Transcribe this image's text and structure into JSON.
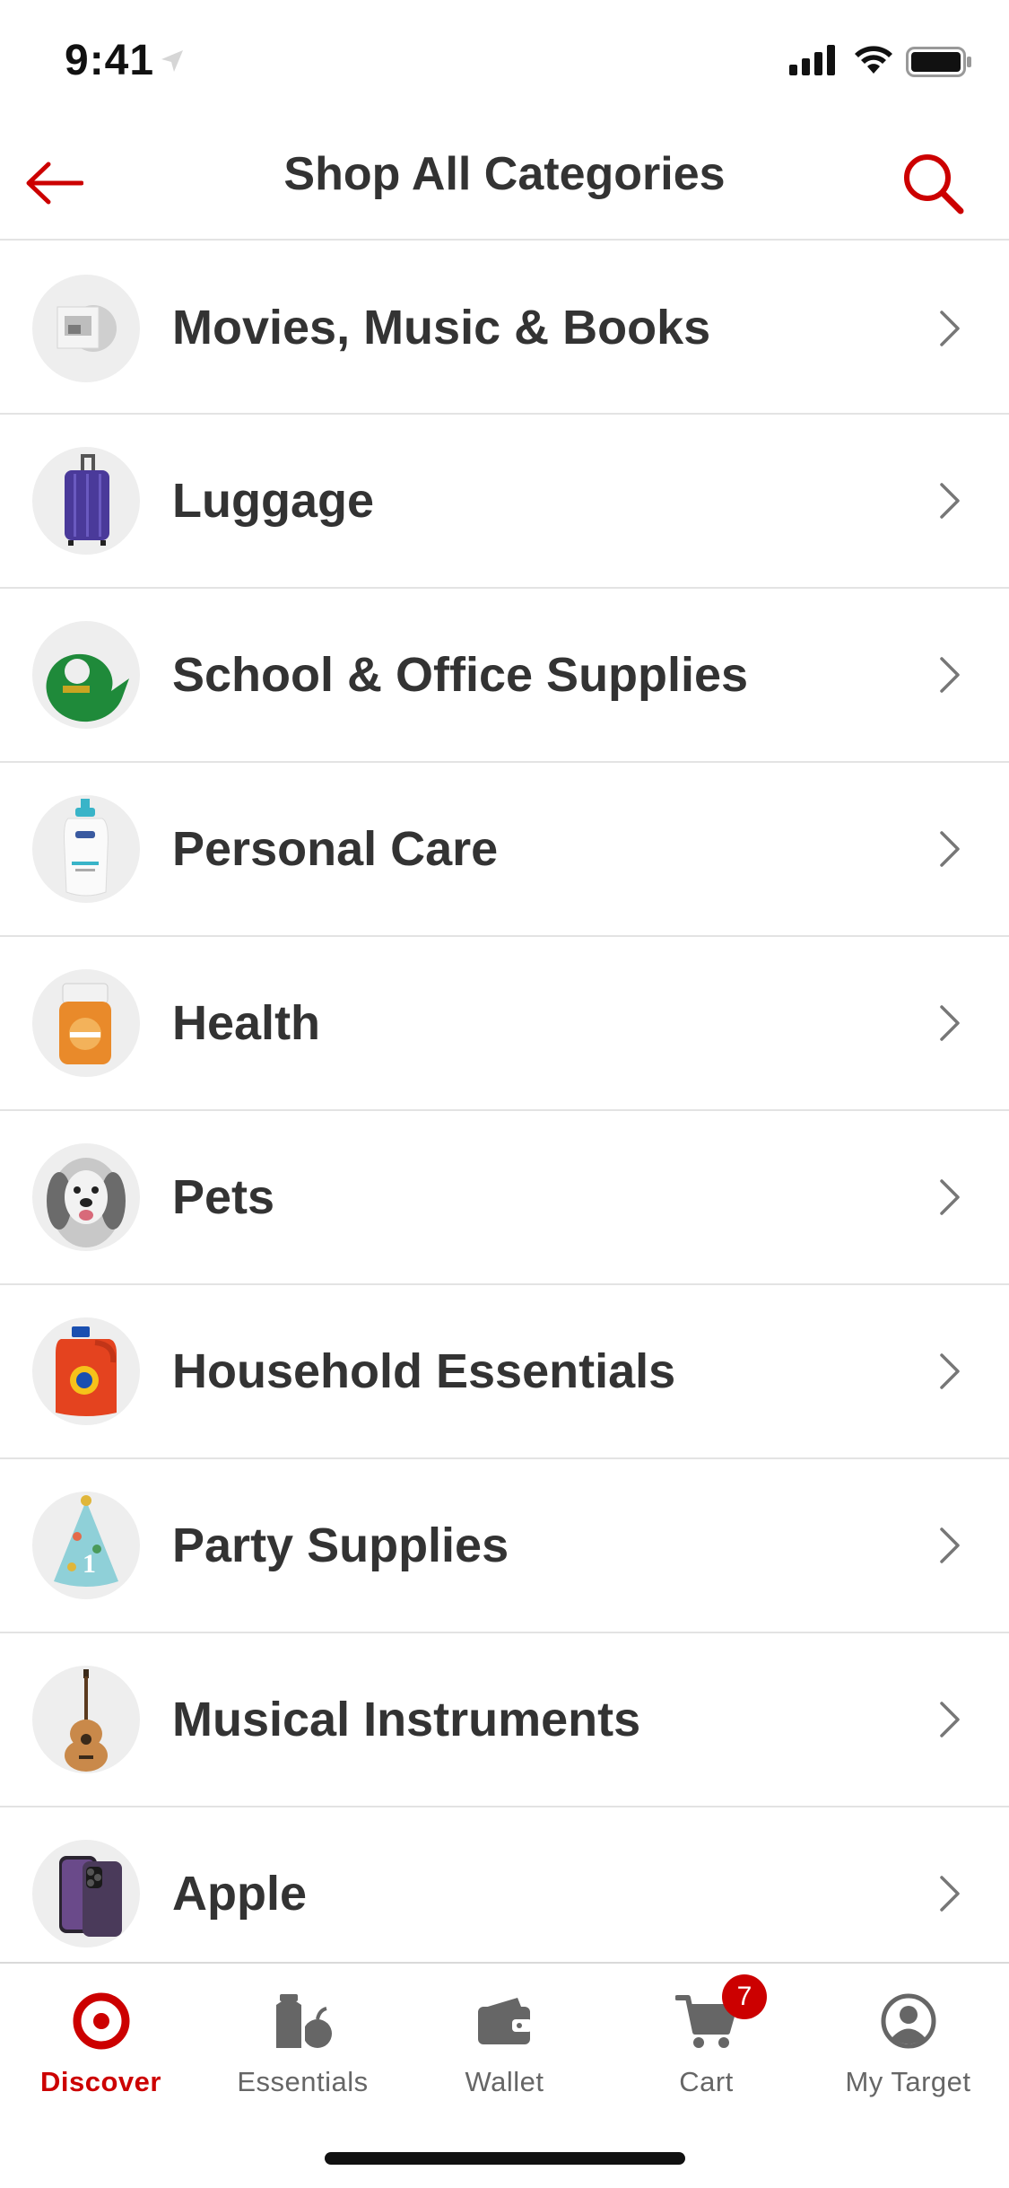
{
  "status_bar": {
    "time": "9:41"
  },
  "header": {
    "title": "Shop All Categories",
    "back_icon": "back-arrow-icon",
    "search_icon": "search-icon"
  },
  "categories": [
    {
      "label": "Movies, Music & Books",
      "icon": "album-thumbnail"
    },
    {
      "label": "Luggage",
      "icon": "suitcase-thumbnail"
    },
    {
      "label": "School & Office Supplies",
      "icon": "tape-dispenser-thumbnail"
    },
    {
      "label": "Personal Care",
      "icon": "body-wash-thumbnail"
    },
    {
      "label": "Health",
      "icon": "vitamin-jar-thumbnail"
    },
    {
      "label": "Pets",
      "icon": "dog-thumbnail"
    },
    {
      "label": "Household Essentials",
      "icon": "detergent-thumbnail"
    },
    {
      "label": "Party Supplies",
      "icon": "party-hat-thumbnail"
    },
    {
      "label": "Musical Instruments",
      "icon": "guitar-thumbnail"
    },
    {
      "label": "Apple",
      "icon": "iphone-thumbnail"
    }
  ],
  "tabs": [
    {
      "label": "Discover",
      "icon": "target-logo-icon",
      "active": true
    },
    {
      "label": "Essentials",
      "icon": "essentials-icon"
    },
    {
      "label": "Wallet",
      "icon": "wallet-icon"
    },
    {
      "label": "Cart",
      "icon": "cart-icon",
      "badge": "7"
    },
    {
      "label": "My Target",
      "icon": "account-icon"
    }
  ],
  "colors": {
    "brand": "#CC0000",
    "text": "#333333",
    "muted": "#666666",
    "divider": "#E3E3E3"
  }
}
